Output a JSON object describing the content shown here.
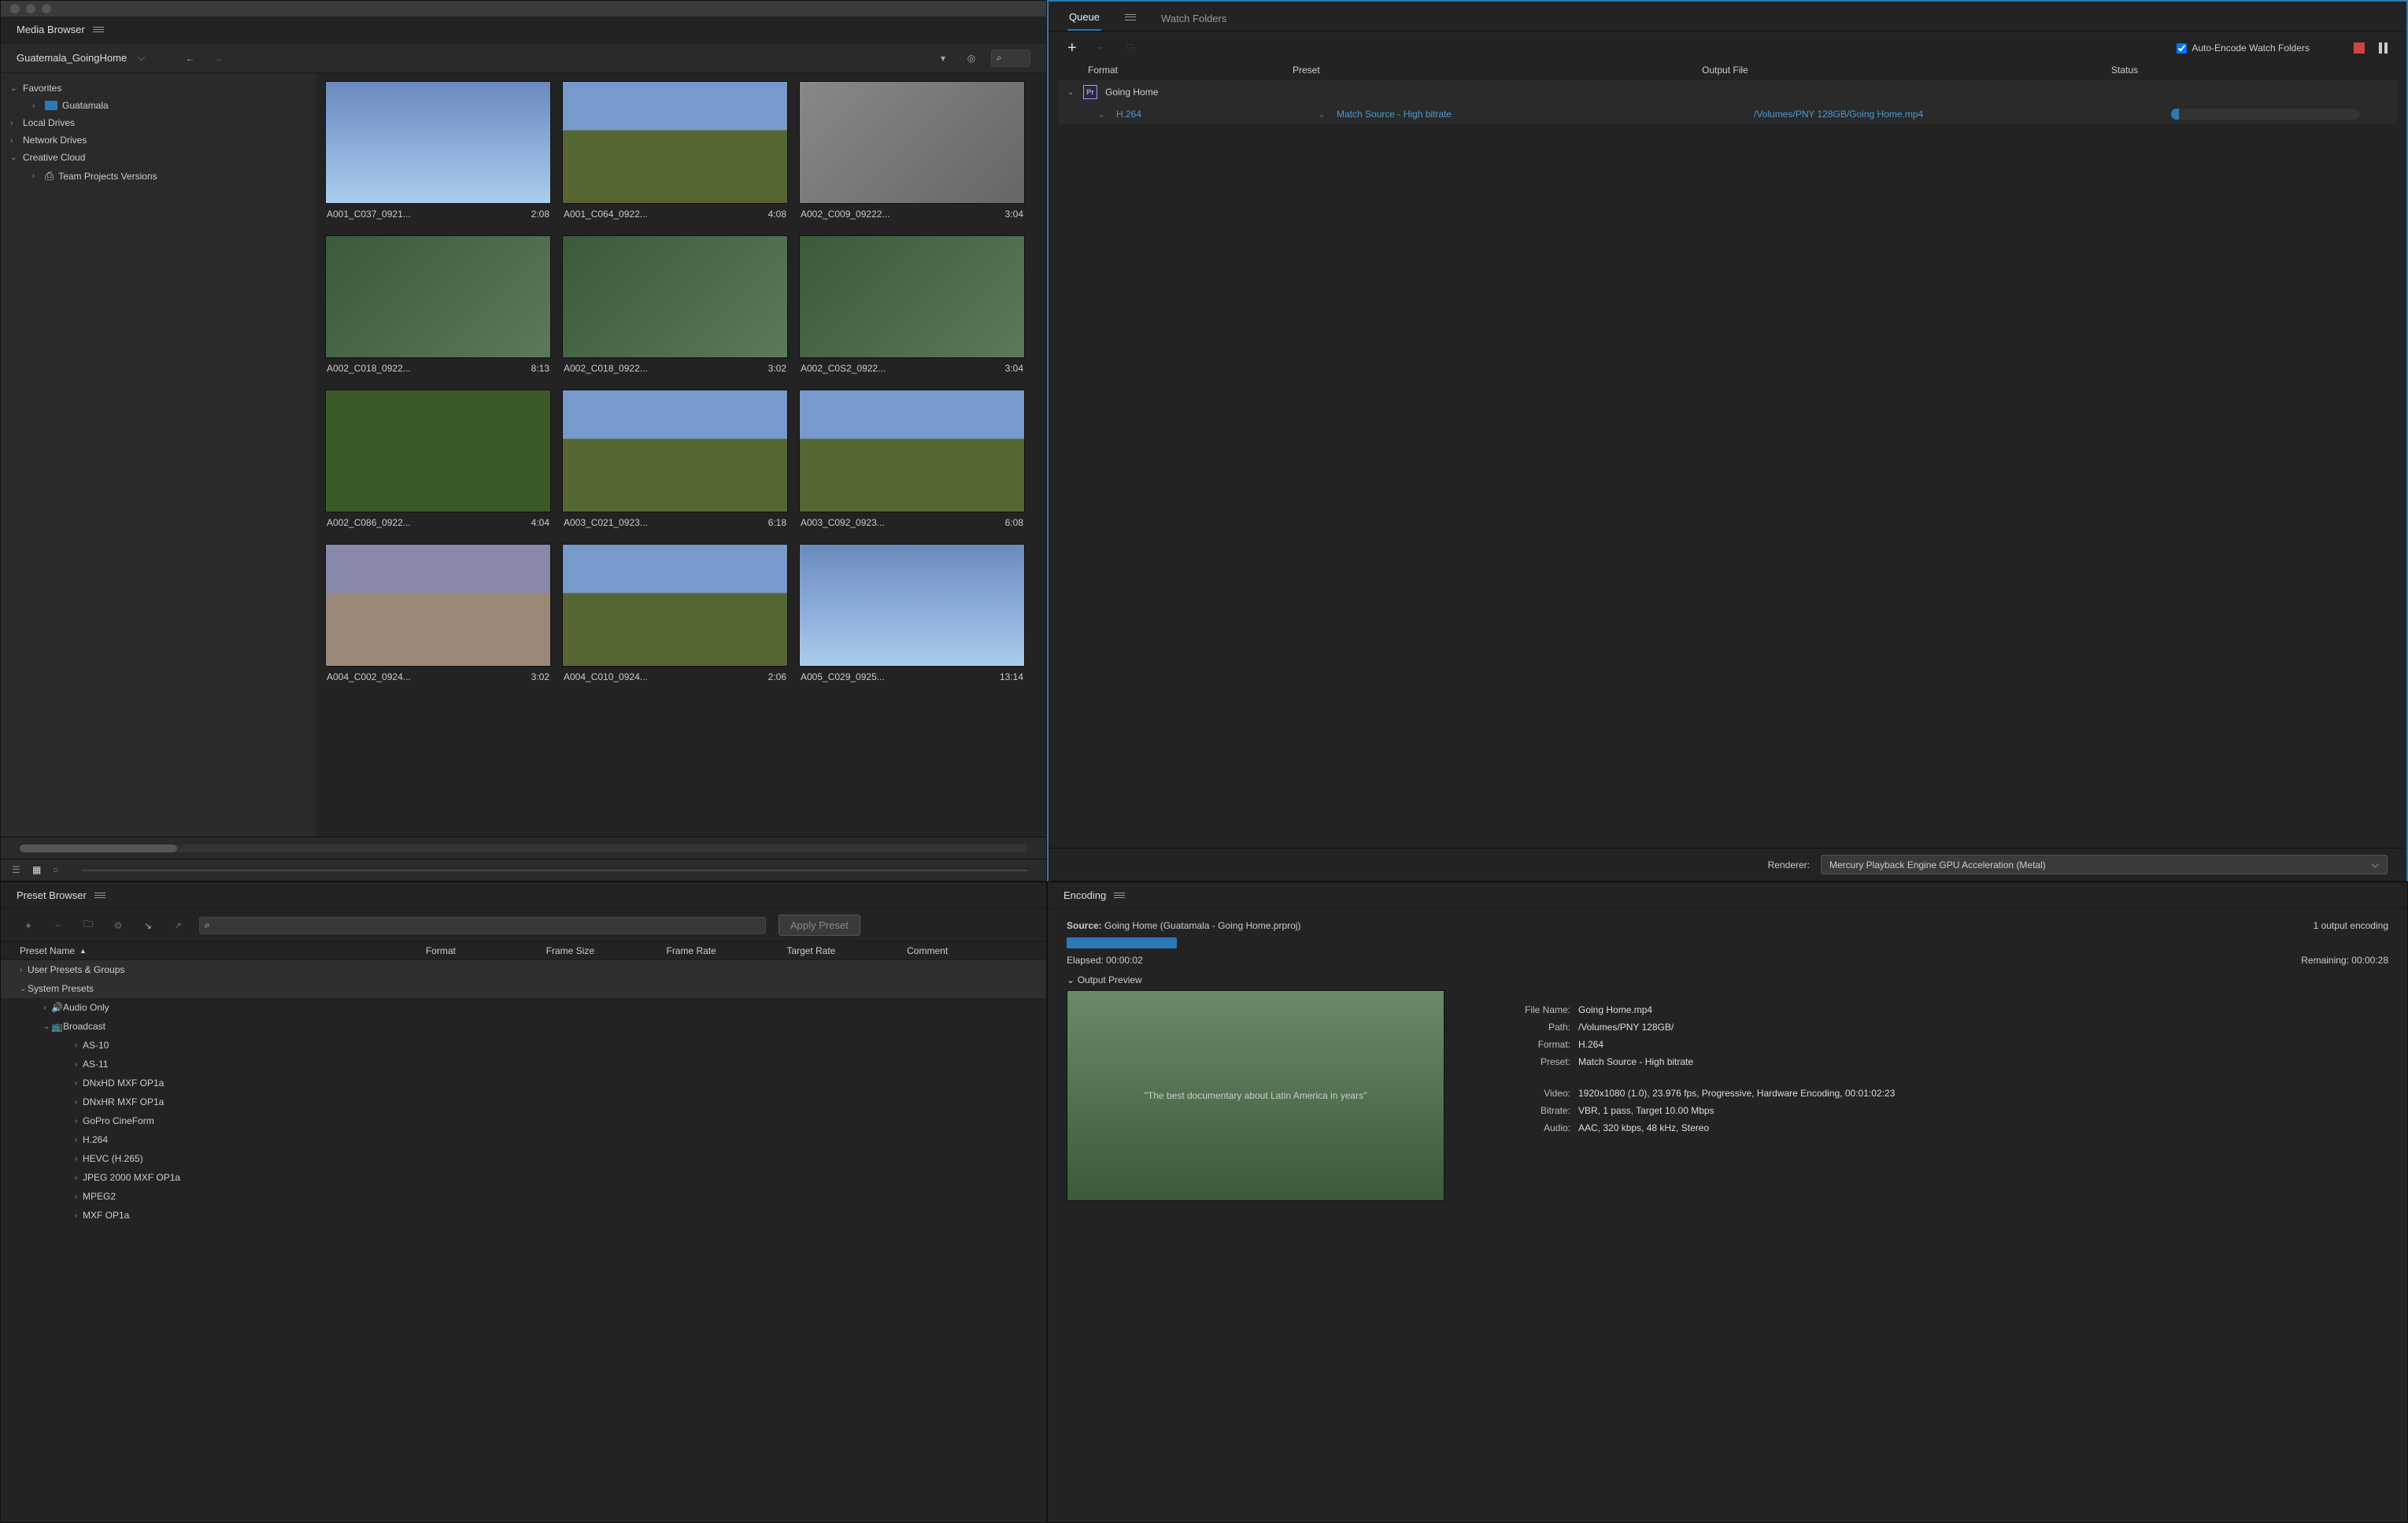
{
  "mediaBrowser": {
    "title": "Media Browser",
    "currentPath": "Guatemala_GoingHome",
    "sidebar": [
      {
        "label": "Favorites",
        "expanded": true,
        "children": [
          {
            "label": "Guatamala",
            "icon": "folder"
          }
        ]
      },
      {
        "label": "Local Drives",
        "expanded": false
      },
      {
        "label": "Network Drives",
        "expanded": false
      },
      {
        "label": "Creative Cloud",
        "expanded": true,
        "children": [
          {
            "label": "Team Projects Versions",
            "icon": "project"
          }
        ]
      }
    ],
    "clips": [
      {
        "name": "A001_C037_0921...",
        "dur": "2:08",
        "cls": "sky"
      },
      {
        "name": "A001_C064_0922...",
        "dur": "4:08",
        "cls": "field"
      },
      {
        "name": "A002_C009_09222...",
        "dur": "3:04",
        "cls": "town"
      },
      {
        "name": "A002_C018_0922...",
        "dur": "8:13",
        "cls": ""
      },
      {
        "name": "A002_C018_0922...",
        "dur": "3:02",
        "cls": ""
      },
      {
        "name": "A002_C0S2_0922...",
        "dur": "3:04",
        "cls": ""
      },
      {
        "name": "A002_C086_0922...",
        "dur": "4:04",
        "cls": "ball"
      },
      {
        "name": "A003_C021_0923...",
        "dur": "6:18",
        "cls": "field"
      },
      {
        "name": "A003_C092_0923...",
        "dur": "6:08",
        "cls": "field"
      },
      {
        "name": "A004_C002_0924...",
        "dur": "3:02",
        "cls": "arch"
      },
      {
        "name": "A004_C010_0924...",
        "dur": "2:06",
        "cls": "field"
      },
      {
        "name": "A005_C029_0925...",
        "dur": "13:14",
        "cls": "sky"
      }
    ]
  },
  "queue": {
    "tabs": [
      "Queue",
      "Watch Folders"
    ],
    "autoEncodeLabel": "Auto-Encode Watch Folders",
    "headers": {
      "format": "Format",
      "preset": "Preset",
      "output": "Output File",
      "status": "Status"
    },
    "job": {
      "name": "Going Home",
      "format": "H.264",
      "preset": "Match Source - High bitrate",
      "output": "/Volumes/PNY 128GB/Going Home.mp4"
    },
    "rendererLabel": "Renderer:",
    "renderer": "Mercury Playback Engine GPU Acceleration (Metal)"
  },
  "presetBrowser": {
    "title": "Preset Browser",
    "applyLabel": "Apply Preset",
    "headers": {
      "name": "Preset Name",
      "format": "Format",
      "frameSize": "Frame Size",
      "frameRate": "Frame Rate",
      "targetRate": "Target Rate",
      "comment": "Comment"
    },
    "tree": [
      {
        "label": "User Presets & Groups",
        "level": 0,
        "expanded": false,
        "group": true
      },
      {
        "label": "System Presets",
        "level": 0,
        "expanded": true,
        "group": true
      },
      {
        "label": "Audio Only",
        "level": 1,
        "expanded": false,
        "icon": "audio"
      },
      {
        "label": "Broadcast",
        "level": 1,
        "expanded": true,
        "icon": "broadcast"
      },
      {
        "label": "AS-10",
        "level": 2
      },
      {
        "label": "AS-11",
        "level": 2
      },
      {
        "label": "DNxHD MXF OP1a",
        "level": 2
      },
      {
        "label": "DNxHR MXF OP1a",
        "level": 2
      },
      {
        "label": "GoPro CineForm",
        "level": 2
      },
      {
        "label": "H.264",
        "level": 2
      },
      {
        "label": "HEVC (H.265)",
        "level": 2
      },
      {
        "label": "JPEG 2000 MXF OP1a",
        "level": 2
      },
      {
        "label": "MPEG2",
        "level": 2
      },
      {
        "label": "MXF OP1a",
        "level": 2
      }
    ]
  },
  "encoding": {
    "title": "Encoding",
    "sourceLabel": "Source:",
    "sourceValue": "Going Home (Guatamala - Going Home.prproj)",
    "outputs": "1 output encoding",
    "elapsedLabel": "Elapsed:",
    "elapsed": "00:00:02",
    "remainingLabel": "Remaining:",
    "remaining": "00:00:28",
    "previewLabel": "Output Preview",
    "previewText": "\"The best documentary about Latin America in years\"",
    "info": {
      "fileNameLabel": "File Name:",
      "fileName": "Going Home.mp4",
      "pathLabel": "Path:",
      "path": "/Volumes/PNY 128GB/",
      "formatLabel": "Format:",
      "format": "H.264",
      "presetLabel": "Preset:",
      "preset": "Match Source - High bitrate",
      "videoLabel": "Video:",
      "video": "1920x1080 (1.0), 23.976 fps, Progressive, Hardware Encoding, 00:01:02:23",
      "bitrateLabel": "Bitrate:",
      "bitrate": "VBR, 1 pass, Target 10.00 Mbps",
      "audioLabel": "Audio:",
      "audio": "AAC, 320 kbps, 48 kHz, Stereo"
    }
  }
}
